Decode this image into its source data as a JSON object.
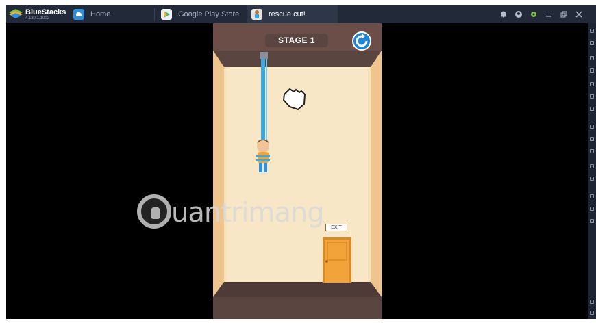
{
  "app": {
    "brand_name": "BlueStacks",
    "brand_version": "4.130.1.1002"
  },
  "tabs": [
    {
      "label": "Home",
      "icon": "home-icon"
    },
    {
      "label": "Google Play Store",
      "icon": "play-store-icon"
    },
    {
      "label": "rescue cut!",
      "icon": "rescue-cut-app-icon"
    }
  ],
  "titlebar_buttons": [
    "bell-icon",
    "account-icon",
    "settings-gear-icon",
    "minimize-icon",
    "restore-icon",
    "close-icon"
  ],
  "game": {
    "stage_label": "STAGE 1",
    "exit_label": "EXIT",
    "restart_icon": "restart-icon"
  },
  "watermark": {
    "text": "uantrimang"
  },
  "colors": {
    "titlebar": "#222a3a",
    "active_tab": "#2e3749",
    "wall": "#f5e2bb",
    "ceiling": "#5a4541",
    "rope": "#39a9e0",
    "door": "#f2a43a",
    "accent_blue": "#1f86d6"
  }
}
